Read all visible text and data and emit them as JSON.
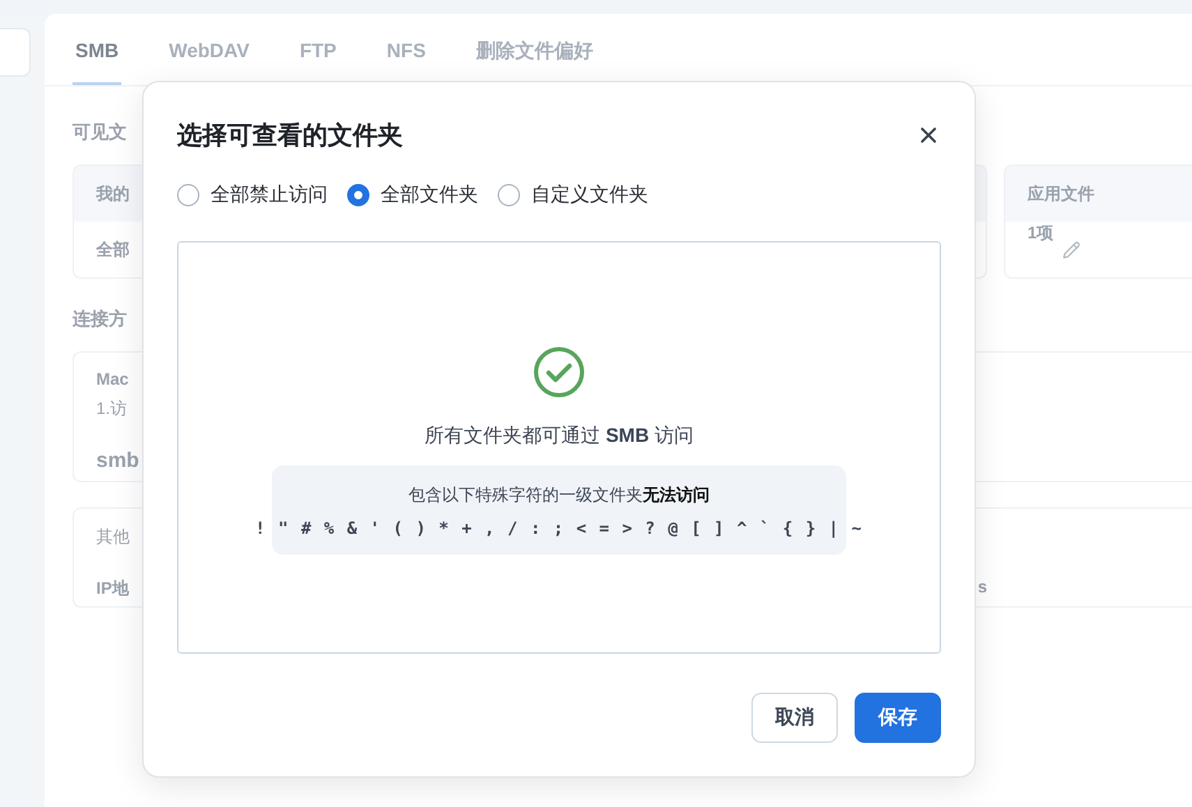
{
  "tabs": [
    {
      "label": "SMB",
      "selected": true
    },
    {
      "label": "WebDAV",
      "selected": false
    },
    {
      "label": "FTP",
      "selected": false
    },
    {
      "label": "NFS",
      "selected": false
    },
    {
      "label": "删除文件偏好",
      "selected": false
    }
  ],
  "visible_section": {
    "title": "可见文",
    "columns": [
      "我的",
      "应用文件"
    ],
    "row": [
      "全部",
      "1项"
    ]
  },
  "connection": {
    "title": "连接方",
    "mac": {
      "name": "Mac",
      "step": "1.访",
      "address": "smb"
    },
    "other": {
      "title": "其他",
      "label": "IP地",
      "value": "s"
    }
  },
  "dialog": {
    "title": "选择可查看的文件夹",
    "options": [
      {
        "label": "全部禁止访问",
        "selected": false
      },
      {
        "label": "全部文件夹",
        "selected": true
      },
      {
        "label": "自定义文件夹",
        "selected": false
      }
    ],
    "message": "所有文件夹都可通过 **SMB** 访问",
    "note": "包含以下特殊字符的一级文件夹**无法访问**",
    "chars": "! \" # % & ' ( ) * + , / : ; < = > ? @ [ ] ^ ` { } | ~",
    "buttons": [
      {
        "label": "取消",
        "kind": "secondary"
      },
      {
        "label": "保存",
        "kind": "primary"
      }
    ]
  }
}
